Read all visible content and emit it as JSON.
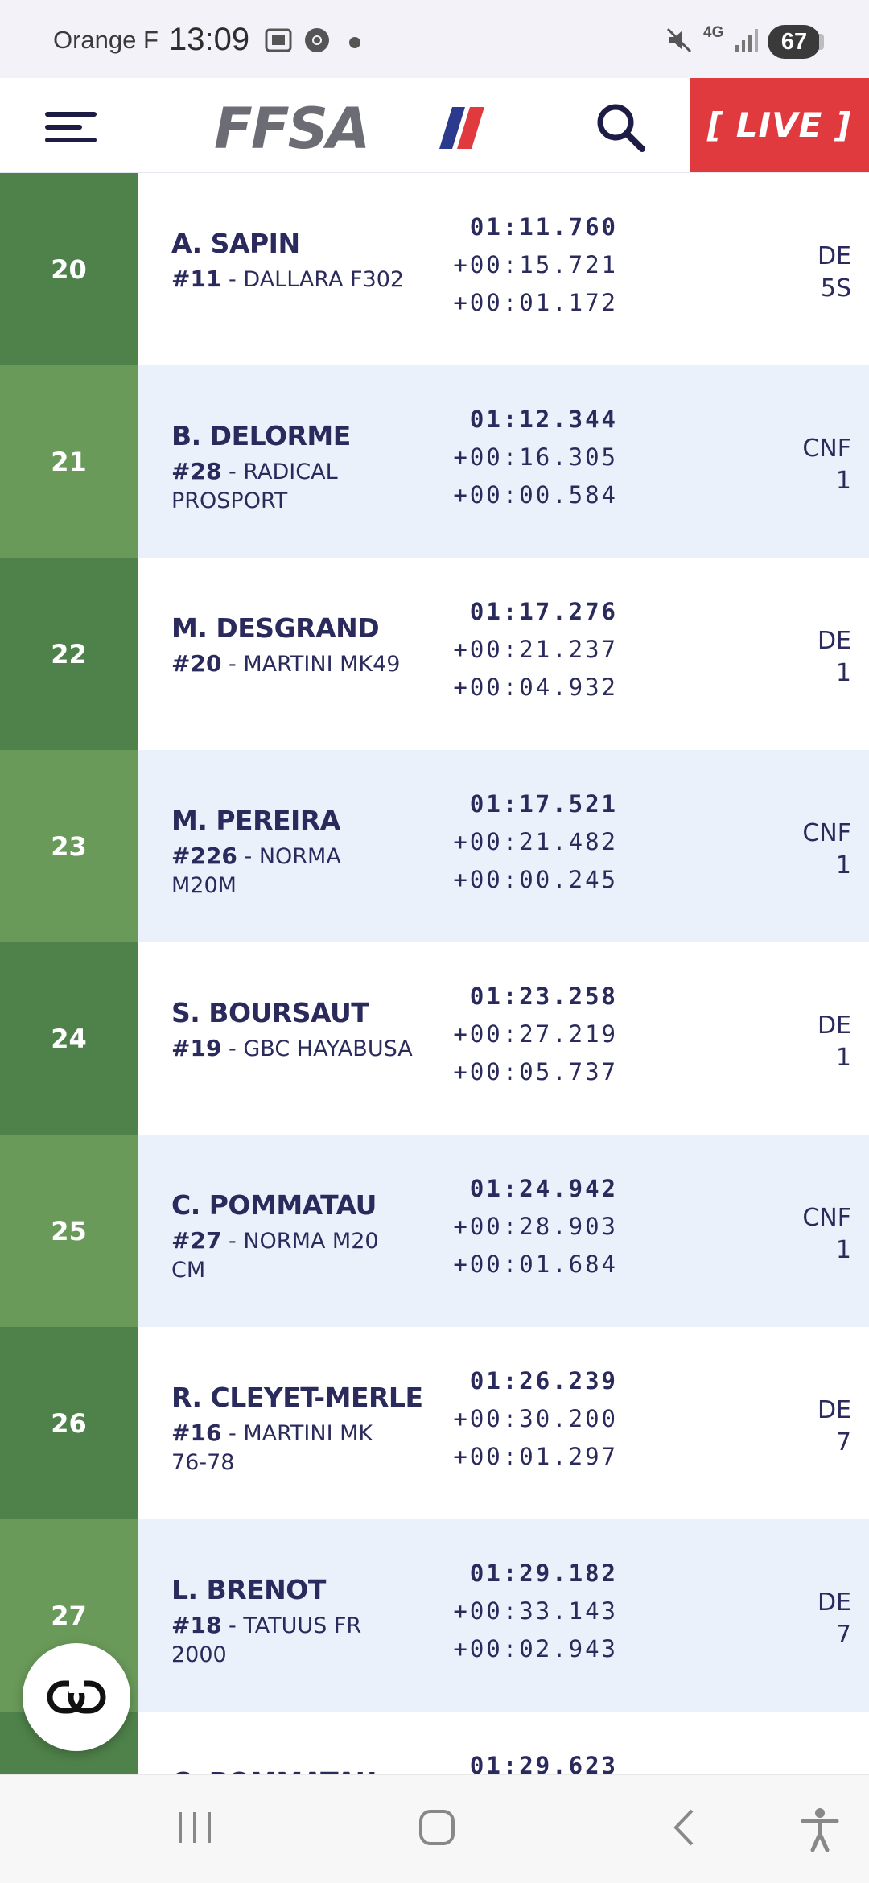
{
  "status_bar": {
    "carrier": "Orange F",
    "time": "13:09",
    "network": "4G",
    "battery": "67",
    "icons": [
      "screenshot-icon",
      "chrome-icon",
      "notification-dot-icon",
      "mute-icon",
      "network-4g-icon",
      "signal-icon",
      "battery-icon"
    ]
  },
  "header": {
    "logo_text": "FFSA",
    "live_label": "[ LIVE ]",
    "icons": [
      "menu-icon",
      "search-icon"
    ],
    "colors": {
      "live_bg": "#e03a3e",
      "logo_grey": "#6c6c74",
      "flag_blue": "#2b3a8c",
      "flag_red": "#e03a3e"
    }
  },
  "rows": [
    {
      "pos": "20",
      "driver": "A. SAPIN",
      "num": "#11",
      "car": "DALLARA F302",
      "time": "01:11.760",
      "gap": "+00:15.721",
      "interval": "+00:01.172",
      "cat1": "DE",
      "cat2": "5S"
    },
    {
      "pos": "21",
      "driver": "B. DELORME",
      "num": "#28",
      "car": "RADICAL PROSPORT",
      "time": "01:12.344",
      "gap": "+00:16.305",
      "interval": "+00:00.584",
      "cat1": "CNF",
      "cat2": "1"
    },
    {
      "pos": "22",
      "driver": "M. DESGRAND",
      "num": "#20",
      "car": "MARTINI MK49",
      "time": "01:17.276",
      "gap": "+00:21.237",
      "interval": "+00:04.932",
      "cat1": "DE",
      "cat2": "1"
    },
    {
      "pos": "23",
      "driver": "M. PEREIRA",
      "num": "#226",
      "car": "NORMA M20M",
      "time": "01:17.521",
      "gap": "+00:21.482",
      "interval": "+00:00.245",
      "cat1": "CNF",
      "cat2": "1"
    },
    {
      "pos": "24",
      "driver": "S. BOURSAUT",
      "num": "#19",
      "car": "GBC HAYABUSA",
      "time": "01:23.258",
      "gap": "+00:27.219",
      "interval": "+00:05.737",
      "cat1": "DE",
      "cat2": "1"
    },
    {
      "pos": "25",
      "driver": "C. POMMATAU",
      "num": "#27",
      "car": "NORMA M20 CM",
      "time": "01:24.942",
      "gap": "+00:28.903",
      "interval": "+00:01.684",
      "cat1": "CNF",
      "cat2": "1"
    },
    {
      "pos": "26",
      "driver": "R. CLEYET-MERLE",
      "num": "#16",
      "car": "MARTINI MK 76-78",
      "time": "01:26.239",
      "gap": "+00:30.200",
      "interval": "+00:01.297",
      "cat1": "DE",
      "cat2": "7"
    },
    {
      "pos": "27",
      "driver": "L. BRENOT",
      "num": "#18",
      "car": "TATUUS FR 2000",
      "time": "01:29.182",
      "gap": "+00:33.143",
      "interval": "+00:02.943",
      "cat1": "DE",
      "cat2": "7"
    },
    {
      "pos": "",
      "driver": "C. POMMATAU",
      "num": "",
      "car": "",
      "time": "01:29.623",
      "gap": "",
      "interval": "",
      "cat1": "",
      "cat2": ""
    }
  ],
  "colors": {
    "pos_dark": "#4f824a",
    "pos_light": "#6a9a5a",
    "row_alt_bg": "#eaf1fb",
    "text": "#2a2a5c"
  },
  "fab": {
    "icon": "link-icon"
  },
  "nav_bar": {
    "icons": [
      "recent-apps-icon",
      "home-icon",
      "back-icon",
      "accessibility-icon"
    ]
  }
}
